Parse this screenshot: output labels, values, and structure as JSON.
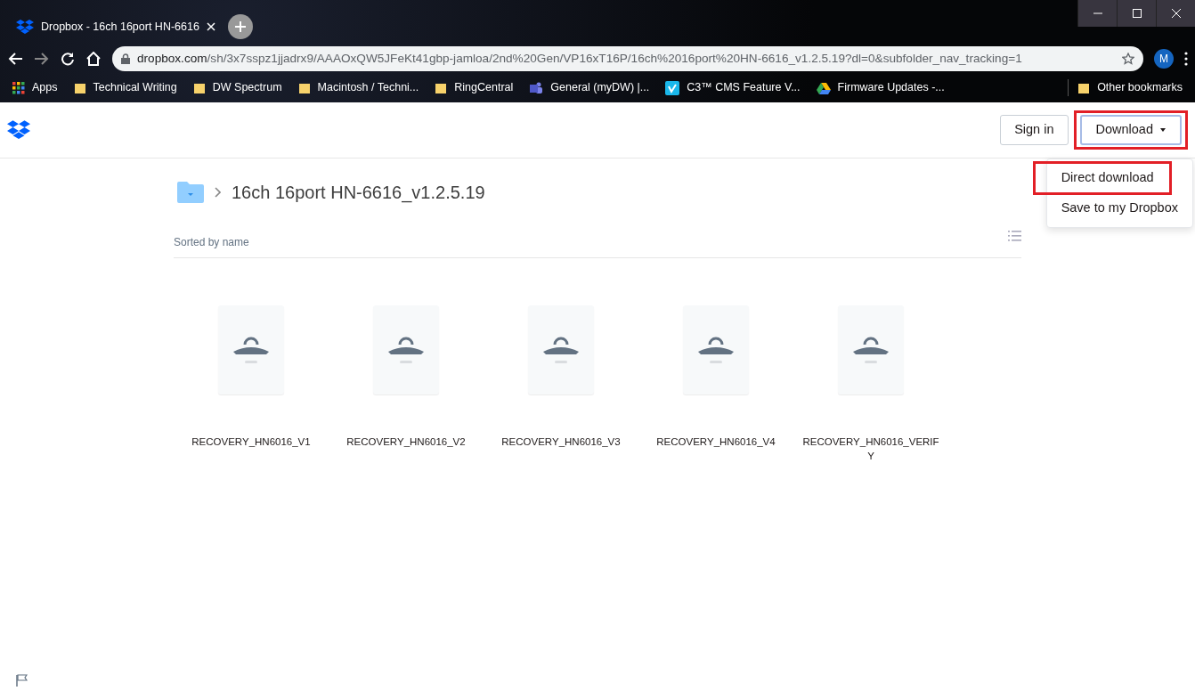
{
  "browser": {
    "tab_title": "Dropbox - 16ch 16port HN-6616",
    "address": "dropbox.com/sh/3x7sspz1jjadrx9/AAAOxQW5JFeKt41gbp-jamloa/2nd%20Gen/VP16xT16P/16ch%2016port%20HN-6616_v1.2.5.19?dl=0&subfolder_nav_tracking=1",
    "profile_initial": "M",
    "bookmarks": [
      {
        "label": "Apps",
        "kind": "apps"
      },
      {
        "label": "Technical Writing",
        "kind": "folder"
      },
      {
        "label": "DW Spectrum",
        "kind": "folder"
      },
      {
        "label": "Macintosh / Techni...",
        "kind": "folder"
      },
      {
        "label": "RingCentral",
        "kind": "folder"
      },
      {
        "label": "General (myDW) |...",
        "kind": "teams"
      },
      {
        "label": "C3™ CMS Feature V...",
        "kind": "vimeo"
      },
      {
        "label": "Firmware Updates -...",
        "kind": "drive"
      }
    ],
    "other_bookmarks": "Other bookmarks"
  },
  "header": {
    "sign_in": "Sign in",
    "download": {
      "label": "Download",
      "highlighted": true,
      "expanded": true
    }
  },
  "download_menu": [
    {
      "label": "Direct download",
      "highlighted": true
    },
    {
      "label": "Save to my Dropbox",
      "highlighted": false
    }
  ],
  "breadcrumb": {
    "folder": "16ch 16port HN-6616_v1.2.5.19"
  },
  "sort_label": "Sorted by name",
  "files": [
    {
      "name": "RECOVERY_HN6016_V1"
    },
    {
      "name": "RECOVERY_HN6016_V2"
    },
    {
      "name": "RECOVERY_HN6016_V3"
    },
    {
      "name": "RECOVERY_HN6016_V4"
    },
    {
      "name": "RECOVERY_HN6016_VERIFY"
    }
  ]
}
